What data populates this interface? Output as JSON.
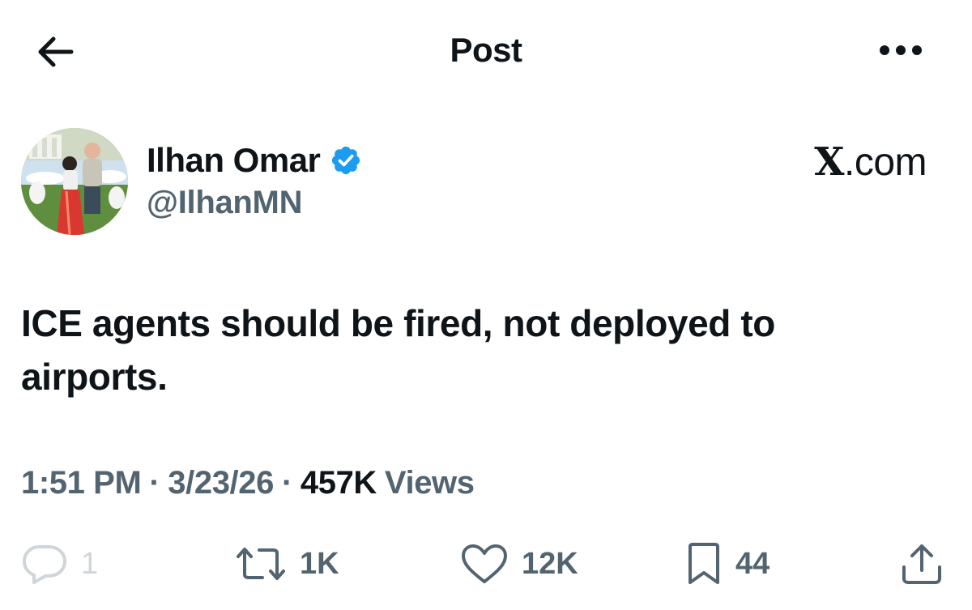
{
  "header": {
    "title": "Post",
    "back_icon": "back-arrow-icon",
    "more_icon": "more-dots-icon"
  },
  "author": {
    "display_name": "Ilhan Omar",
    "handle": "@IlhanMN",
    "verified": true,
    "verified_color": "#1d9bf0"
  },
  "watermark": {
    "x": "X",
    "dotcom": ".com"
  },
  "post": {
    "text": "ICE agents should be fired, not deployed to airports."
  },
  "meta": {
    "time": "1:51 PM",
    "date": "3/23/26",
    "separator": "·",
    "views_count": "457K",
    "views_label": "Views"
  },
  "actions": {
    "reply": {
      "icon": "reply-bubble-icon",
      "count": "1"
    },
    "repost": {
      "icon": "repost-icon",
      "count": "1K"
    },
    "like": {
      "icon": "heart-icon",
      "count": "12K"
    },
    "bookmark": {
      "icon": "bookmark-icon",
      "count": "44"
    },
    "share": {
      "icon": "share-icon"
    }
  },
  "colors": {
    "text_primary": "#0f1419",
    "text_secondary": "#536471",
    "accent": "#1d9bf0"
  }
}
